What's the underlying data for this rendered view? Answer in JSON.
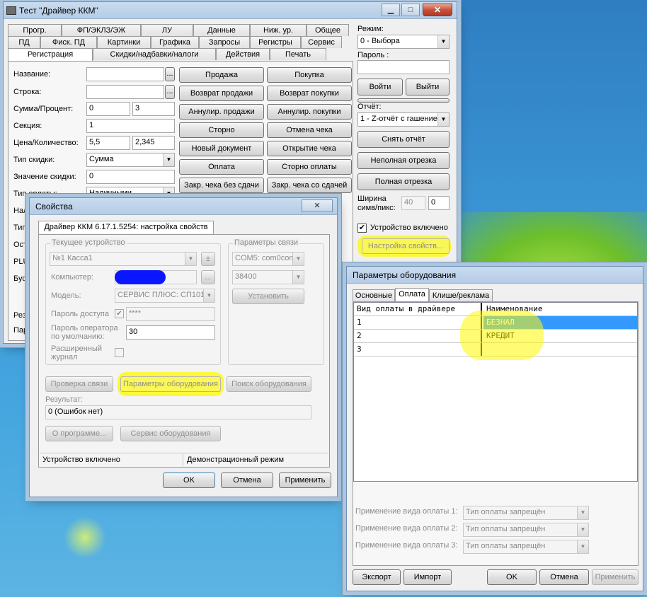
{
  "main": {
    "title": "Тест \"Драйвер ККМ\"",
    "tabs_row1": [
      "Прогр.",
      "ФП/ЭКЛЗ/ЭЖ",
      "ЛУ",
      "Данные",
      "Ниж. ур.",
      "Общее"
    ],
    "tabs_row2": [
      "ПД",
      "Фиск. ПД",
      "Картинки",
      "Графика",
      "Запросы",
      "Регистры",
      "Сервис"
    ],
    "tabs_row3": [
      "Регистрация",
      "Скидки/надбавки/налоги",
      "Действия",
      "Печать"
    ],
    "fields": {
      "name_label": "Название:",
      "string_label": "Строка:",
      "sum_label": "Сумма/Процент:",
      "sum_value": "0",
      "percent_value": "3",
      "section_label": "Секция:",
      "section_value": "1",
      "price_label": "Цена/Количество:",
      "price_value": "5,5",
      "qty_value": "2,345",
      "discount_type_label": "Тип скидки:",
      "discount_type_value": "Сумма",
      "discount_value_label": "Значение скидки:",
      "discount_value": "0",
      "payment_type_label": "Тип оплаты:",
      "payment_type_value": "Наличными",
      "partial_labels": [
        "Нал",
        "Тип",
        "Ост",
        "PLU",
        "Буф",
        "Рез",
        "Пар"
      ],
      "ellipsis": "..."
    },
    "buttons_left": [
      "Продажа",
      "Возврат продажи",
      "Аннулир. продажи",
      "Сторно",
      "Новый документ",
      "Оплата",
      "Закр. чека без сдачи"
    ],
    "buttons_right": [
      "Покупка",
      "Возврат покупки",
      "Аннулир. покупки",
      "Отмена чека",
      "Открытие чека",
      "Сторно оплаты",
      "Закр. чека со сдачей"
    ],
    "side": {
      "mode_label": "Режим:",
      "mode_value": "0 - Выбора",
      "password_label": "Пароль :",
      "login": "Войти",
      "logout": "Выйти",
      "report_label": "Отчёт:",
      "report_value": "1 - Z-отчёт с гашение",
      "take_report": "Снять отчёт",
      "partial_cut": "Неполная отрезка",
      "full_cut": "Полная отрезка",
      "width_label_1": "Ширина",
      "width_label_2": "симв/пикс:",
      "width_chars": "40",
      "width_px": "0",
      "device_enabled": "Устройство включено",
      "settings_button": "Настройка свойств..."
    }
  },
  "props": {
    "title": "Свойства",
    "tab": "Драйвер ККМ 6.17.1.5254: настройка свойств",
    "current_device_group": "Текущее устройство",
    "device_value": "№1 Касса1",
    "plusminus": "±",
    "computer_label": "Компьютер:",
    "model_label": "Модель:",
    "model_value": "СЕРВИС ПЛЮС: СП101",
    "access_password_label": "Пароль доступа",
    "access_password_value": "****",
    "operator_password_label_1": "Пароль оператора",
    "operator_password_label_2": "по умолчанию:",
    "operator_password_value": "30",
    "extended_journal_1": "Расширенный",
    "extended_journal_2": "журнал",
    "conn_group": "Параметры связи",
    "port_value": "COM5: com0com",
    "baud_value": "38400",
    "install": "Установить",
    "check_conn": "Проверка связи",
    "equip_params": "Параметры оборудования",
    "search_equip": "Поиск оборудования",
    "result_label": "Результат:",
    "result_value": "0 (Ошибок нет)",
    "about": "О программе...",
    "equip_service": "Сервис оборудования",
    "status_left": "Устройство включено",
    "status_right": "Демонстрационный режим",
    "ok": "OK",
    "cancel": "Отмена",
    "apply": "Применить"
  },
  "equip": {
    "title": "Параметры оборудования",
    "tabs": [
      "Основные",
      "Оплата",
      "Клише/реклама"
    ],
    "grid_headers": [
      "Вид оплаты в драйвере",
      "Наименование"
    ],
    "grid_rows": [
      {
        "id": "1",
        "name": "БЕЗНАЛ"
      },
      {
        "id": "2",
        "name": "КРЕДИТ"
      },
      {
        "id": "3",
        "name": ""
      }
    ],
    "apply_labels": [
      "Применение вида оплаты 1:",
      "Применение вида оплаты 2:",
      "Применение вида оплаты 3:"
    ],
    "apply_value": "Тип оплаты запрещён",
    "export": "Экспорт",
    "import": "Импорт",
    "ok": "OK",
    "cancel": "Отмена",
    "apply": "Применить"
  },
  "colors": {
    "highlight": "#fff500",
    "selection": "#3399ff",
    "redaction": "#0a16ff"
  }
}
